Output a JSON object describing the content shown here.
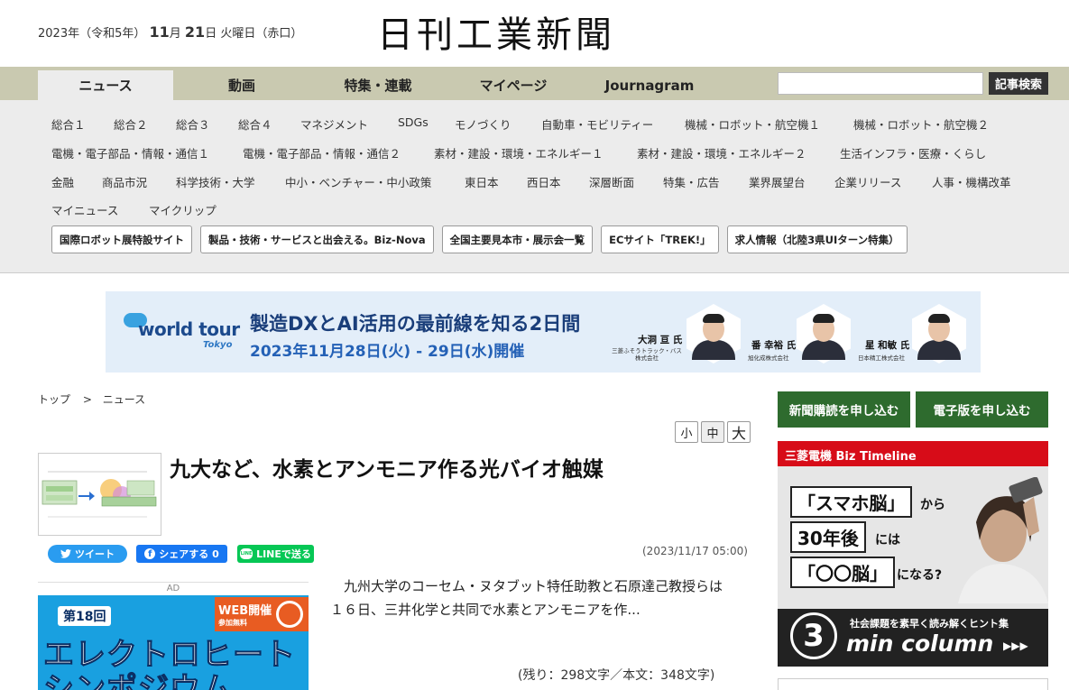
{
  "header": {
    "date_prefix": "2023年（令和5年）",
    "month": "11",
    "month_unit": "月",
    "day": "21",
    "day_unit": "日",
    "weekday": "火曜日（赤口）",
    "logo": "日刊工業新聞"
  },
  "nav": {
    "tabs": [
      "ニュース",
      "動画",
      "特集・連載",
      "マイページ",
      "Journagram"
    ],
    "search_placeholder": "",
    "search_button": "記事検索"
  },
  "categories": {
    "row1": [
      "総合１",
      "総合２",
      "総合３",
      "総合４",
      "マネジメント",
      "SDGs",
      "モノづくり",
      "自動車・モビリティー",
      "機械・ロボット・航空機１",
      "機械・ロボット・航空機２"
    ],
    "row2": [
      "電機・電子部品・情報・通信１",
      "電機・電子部品・情報・通信２",
      "素材・建設・環境・エネルギー１",
      "素材・建設・環境・エネルギー２",
      "生活インフラ・医療・くらし"
    ],
    "row3": [
      "金融",
      "商品市況",
      "科学技術・大学",
      "中小・ベンチャー・中小政策",
      "東日本",
      "西日本",
      "深層断面",
      "特集・広告",
      "業界展望台",
      "企業リリース",
      "人事・機構改革"
    ],
    "row4": [
      "マイニュース",
      "マイクリップ"
    ],
    "special": [
      "国際ロボット展特設サイト",
      "製品・技術・サービスと出会える。Biz-Nova",
      "全国主要見本市・展示会一覧",
      "ECサイト「TREK!」",
      "求人情報（北陸3県UIターン特集）"
    ]
  },
  "banner": {
    "brand": "world tour",
    "city": "Tokyo",
    "headline": "製造DXとAI活用の最前線を知る2日間",
    "date_text": "2023年11月28日(火) - 29日(水)開催",
    "speakers": [
      {
        "name": "大洞 亘 氏",
        "company": "三菱ふそうトラック・バス株式会社"
      },
      {
        "name": "番 幸裕 氏",
        "company": "旭化成株式会社"
      },
      {
        "name": "星 和敏 氏",
        "company": "日本精工株式会社"
      }
    ]
  },
  "breadcrumb": {
    "top": "トップ",
    "sep": ">",
    "current": "ニュース"
  },
  "fontsize": [
    "小",
    "中",
    "大"
  ],
  "article": {
    "title": "九大など、水素とアンモニア作る光バイオ触媒",
    "date": "(2023/11/17 05:00)",
    "lead_1": "九州大学のコーセム・ヌタブット特任助教と石原達己教授らは",
    "lead_2": "１６日、三井化学と共同で水素とアンモニアを作...",
    "remaining": "(残り：298文字／本文：348文字)"
  },
  "share": {
    "tweet": "ツイート",
    "facebook": "シェアする 0",
    "line": "LINEで送る"
  },
  "ad_left": {
    "label": "AD",
    "edition": "第18回",
    "web_label": "WEB開催",
    "web_sub": "参加無料",
    "line1": "エレクトロヒート",
    "line2": "シンポジウム"
  },
  "right": {
    "subscribe_paper": "新聞購読を申し込む",
    "subscribe_digital": "電子版を申し込む"
  },
  "ad_right": {
    "brand": "三菱電機 Biz Timeline",
    "box1": "「スマホ脳」",
    "suffix1": "から",
    "box2": "30年後",
    "suffix2": "には",
    "box3": "「〇〇脳」",
    "suffix3": "になる?",
    "number": "3",
    "hint": "社会課題を素早く読み解くヒント集",
    "column": "min column",
    "arrow": "▶▶▶"
  },
  "colors": {
    "nav_bg": "#c9c9b0",
    "subscribe_green": "#2e6b2e",
    "twitter": "#2a9cf0",
    "facebook": "#1877f2",
    "line": "#06c755"
  }
}
